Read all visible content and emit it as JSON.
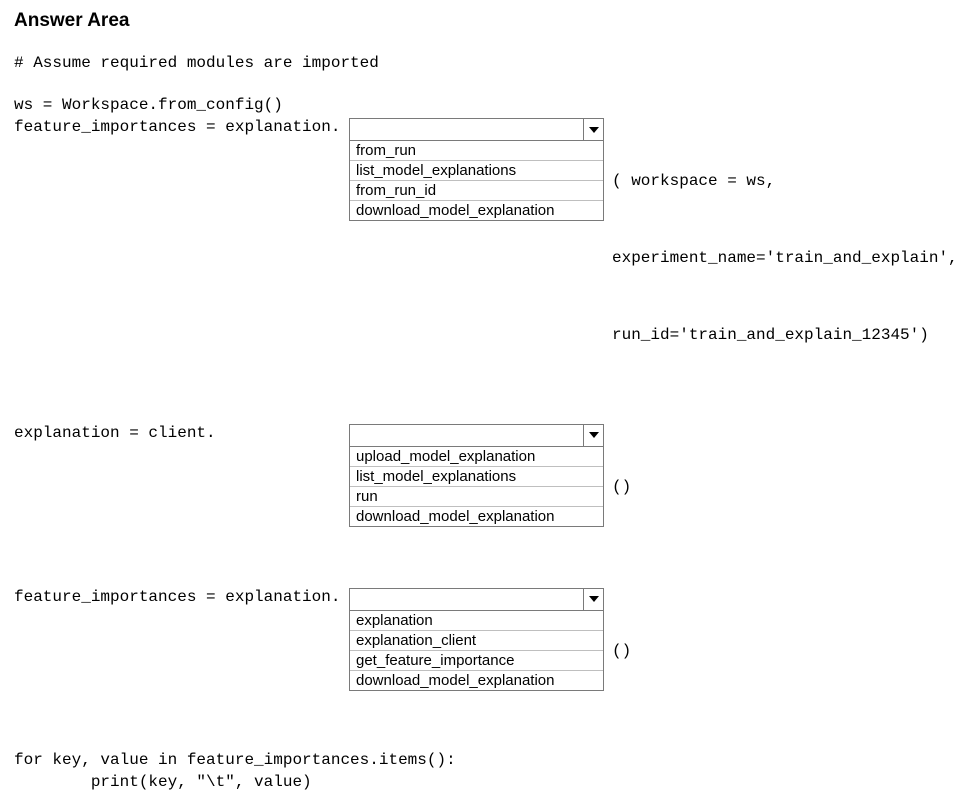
{
  "title": "Answer Area",
  "comment_line": "# Assume required modules are imported",
  "ws_line": "ws = Workspace.from_config()",
  "row1": {
    "left": "feature_importances = explanation.",
    "options": [
      "from_run",
      "list_model_explanations",
      "from_run_id",
      "download_model_explanation"
    ],
    "right1": "( workspace = ws,",
    "right2": "experiment_name='train_and_explain',",
    "right3": "run_id='train_and_explain_12345')"
  },
  "row2": {
    "left": "explanation = client.",
    "options": [
      "upload_model_explanation",
      "list_model_explanations",
      "run",
      "download_model_explanation"
    ],
    "right1": "()"
  },
  "row3": {
    "left": "feature_importances = explanation.",
    "options": [
      "explanation",
      "explanation_client",
      "get_feature_importance",
      "download_model_explanation"
    ],
    "right1": "()"
  },
  "loop_line": "for key, value in feature_importances.items():",
  "print_line": "        print(key, \"\\t\", value)"
}
